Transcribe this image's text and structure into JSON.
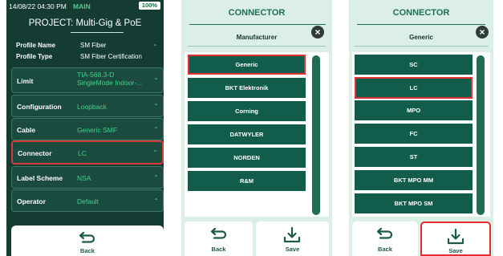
{
  "panel1": {
    "status": {
      "time": "14/08/22 04:30 PM",
      "mode": "MAIN",
      "battery": "100%"
    },
    "project_title": "PROJECT: Multi-Gig & PoE",
    "profile": [
      {
        "label": "Profile Name",
        "value": "SM Fiber"
      },
      {
        "label": "Profile Type",
        "value": "SM Fiber Certification"
      }
    ],
    "rows": [
      {
        "label": "Limit",
        "value": "TIA-568.3-D SingleMode Indoor-..."
      },
      {
        "label": "Configuration",
        "value": "Loopback"
      },
      {
        "label": "Cable",
        "value": "Generic SMF"
      },
      {
        "label": "Connector",
        "value": "LC"
      },
      {
        "label": "Label Scheme",
        "value": "NSA"
      },
      {
        "label": "Operator",
        "value": "Default"
      }
    ],
    "back_label": "Back"
  },
  "panel2": {
    "title": "CONNECTOR",
    "subtitle": "Manufacturer",
    "items": [
      "Generic",
      "BKT Elektronik",
      "Corning",
      "DATWYLER",
      "NORDEN",
      "R&M"
    ],
    "back_label": "Back",
    "save_label": "Save"
  },
  "panel3": {
    "title": "CONNECTOR",
    "subtitle": "Generic",
    "items": [
      "SC",
      "LC",
      "MPO",
      "FC",
      "ST",
      "BKT MPO MM",
      "BKT MPO SM"
    ],
    "back_label": "Back",
    "save_label": "Save"
  },
  "colors": {
    "dark_bg": "#143c33",
    "accent_green": "#3cd68b",
    "item_bg": "#125c4b",
    "highlight": "#e03131",
    "light_bg": "#dcefe7"
  }
}
